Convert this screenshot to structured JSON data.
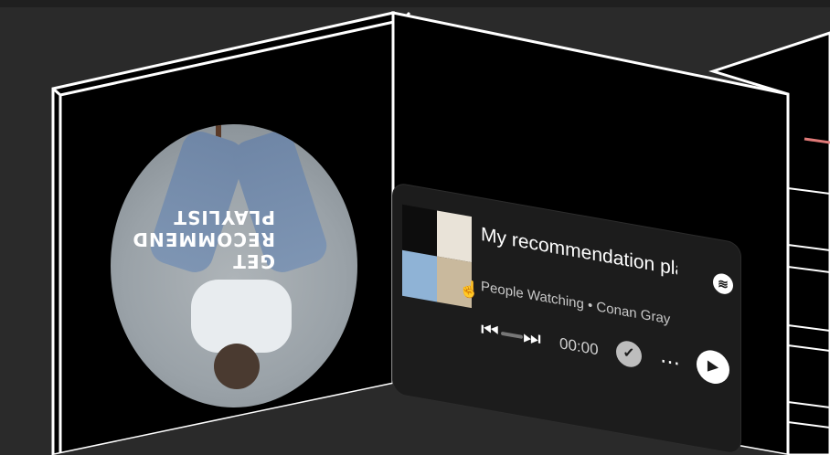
{
  "colors": {
    "background": "#2a2a2a",
    "panel": "#000000",
    "outline": "#ffffff",
    "card": "#1c1c1c",
    "accent_line": "#e07a78"
  },
  "cover": {
    "lines": [
      "GET",
      "RECOMMEND",
      "PLAYLIST"
    ]
  },
  "player": {
    "title": "My recommendation playlist",
    "subtitle": "People Watching • Conan Gray",
    "time": "00:00",
    "icons": {
      "logo": "spotify-icon",
      "previous": "skip-previous-icon",
      "next": "skip-next-icon",
      "saved": "check-circle-icon",
      "more": "more-horizontal-icon",
      "play": "play-icon",
      "cursor": "pointer-hand-icon"
    },
    "progress": 0
  }
}
